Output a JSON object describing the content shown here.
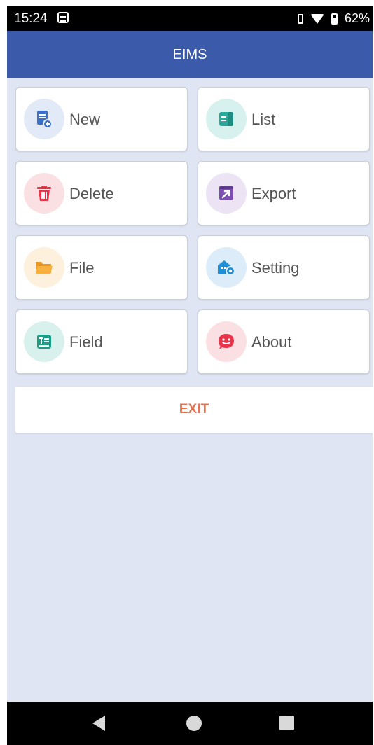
{
  "status_bar": {
    "time": "15:24",
    "battery": "62%"
  },
  "app_bar": {
    "title": "EIMS"
  },
  "menu": [
    {
      "id": "new",
      "label": "New",
      "icon": "new-document-icon",
      "color": "#3c6fc8",
      "bg": "#e2e9f7"
    },
    {
      "id": "list",
      "label": "List",
      "icon": "list-icon",
      "color": "#2aa89a",
      "bg": "#d7f1ee"
    },
    {
      "id": "delete",
      "label": "Delete",
      "icon": "trash-icon",
      "color": "#e8334a",
      "bg": "#fbe0e3"
    },
    {
      "id": "export",
      "label": "Export",
      "icon": "export-icon",
      "color": "#7a4fb0",
      "bg": "#ece3f5"
    },
    {
      "id": "file",
      "label": "File",
      "icon": "folder-icon",
      "color": "#f5a531",
      "bg": "#fdf0dc"
    },
    {
      "id": "setting",
      "label": "Setting",
      "icon": "setting-icon",
      "color": "#1f8fd6",
      "bg": "#dcedf9"
    },
    {
      "id": "field",
      "label": "Field",
      "icon": "field-icon",
      "color": "#1f9c86",
      "bg": "#d8f1ec"
    },
    {
      "id": "about",
      "label": "About",
      "icon": "about-icon",
      "color": "#e8334a",
      "bg": "#fbe0e3"
    }
  ],
  "exit_label": "EXIT",
  "colors": {
    "appbar": "#3c5aaa",
    "background": "#dfe5f2",
    "exit": "#e8704d"
  }
}
